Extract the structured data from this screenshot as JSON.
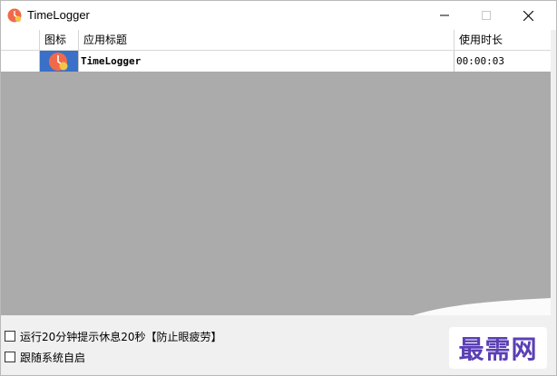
{
  "window": {
    "title": "TimeLogger",
    "app_icon": "timelogger-clock-icon",
    "controls": [
      "minimize-icon",
      "maximize-icon",
      "close-icon"
    ]
  },
  "list": {
    "columns": [
      "",
      "图标",
      "应用标题",
      "使用时长"
    ],
    "rows": [
      {
        "index": "",
        "icon": "timelogger-clock-icon",
        "title": "TimeLogger",
        "duration": "00:00:03"
      }
    ]
  },
  "options": {
    "rest_reminder": {
      "label": "运行20分钟提示休息20秒【防止眼疲劳】",
      "checked": false
    },
    "autostart": {
      "label": "跟随系统自启",
      "checked": false
    }
  },
  "watermark": {
    "text": "最需网"
  },
  "colors": {
    "list_background": "#ababab",
    "selection_blue": "#3a70c7",
    "icon_orange": "#f06a4a",
    "icon_yellow": "#f5c447",
    "watermark_purple": "#5a3fb5"
  }
}
